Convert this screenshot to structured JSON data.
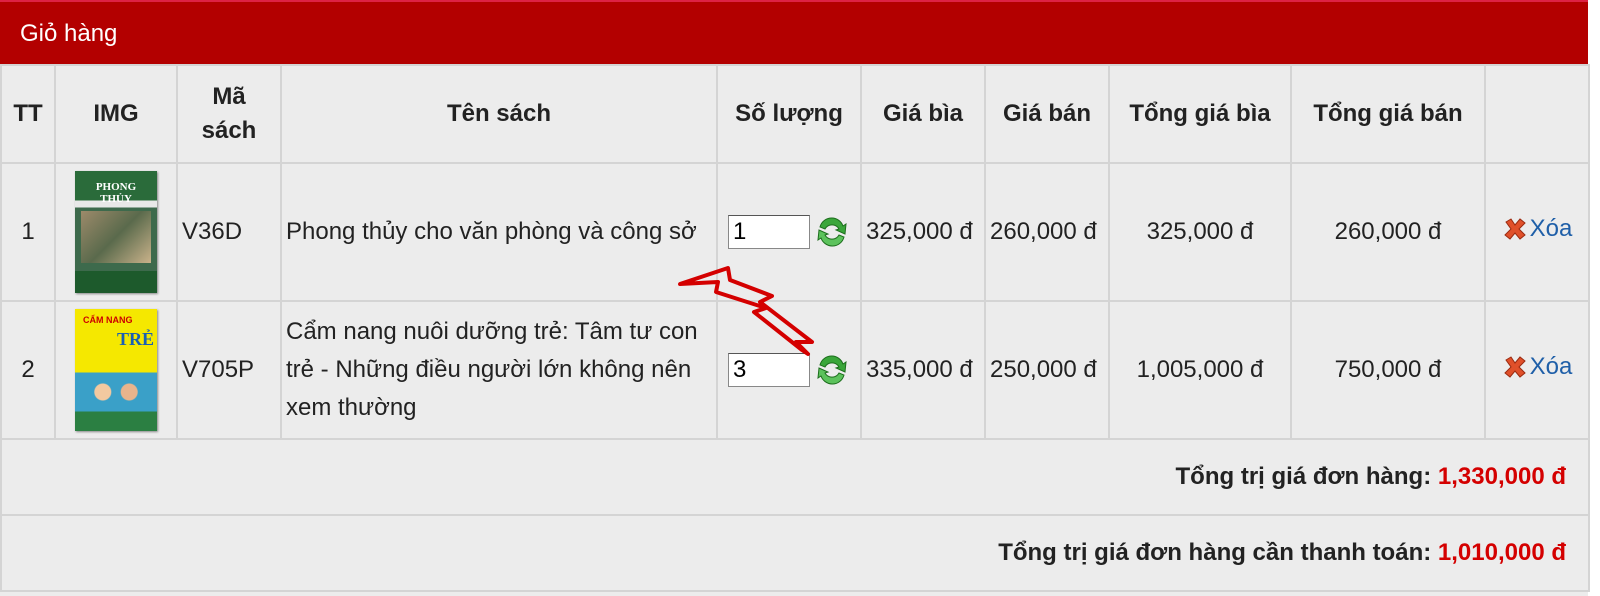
{
  "panel": {
    "title": "Giỏ hàng"
  },
  "table": {
    "headers": {
      "tt": "TT",
      "img": "IMG",
      "code": "Mã sách",
      "name": "Tên sách",
      "qty": "Số lượng",
      "cover_price": "Giá bìa",
      "sale_price": "Giá bán",
      "total_cover": "Tổng giá bìa",
      "total_sale": "Tổng giá bán"
    },
    "rows": [
      {
        "tt": "1",
        "code": "V36D",
        "name": "Phong thủy cho văn phòng và công sở",
        "qty": "1",
        "cover_price": "325,000 đ",
        "sale_price": "260,000 đ",
        "total_cover": "325,000 đ",
        "total_sale": "260,000 đ",
        "delete_label": "Xóa",
        "cover_text": "PHONG THỦY"
      },
      {
        "tt": "2",
        "code": "V705P",
        "name": "Cẩm nang nuôi dưỡng trẻ: Tâm tư con trẻ - Những điều người lớn không nên xem thường",
        "qty": "3",
        "cover_price": "335,000 đ",
        "sale_price": "250,000 đ",
        "total_cover": "1,005,000 đ",
        "total_sale": "750,000 đ",
        "delete_label": "Xóa",
        "cover_text_1": "CẨM NANG",
        "cover_text_2": "TRẺ"
      }
    ]
  },
  "summary": {
    "order_total_label": "Tổng trị giá đơn hàng:",
    "order_total_value": "1,330,000 đ",
    "payable_total_label": "Tổng trị giá đơn hàng cần thanh toán:",
    "payable_total_value": "1,010,000 đ"
  },
  "colors": {
    "header_bg": "#b30000",
    "price_red": "#d40000",
    "link_blue": "#1f5fa8"
  },
  "icons": [
    "refresh-icon",
    "delete-x-icon",
    "annotation-arrow"
  ]
}
